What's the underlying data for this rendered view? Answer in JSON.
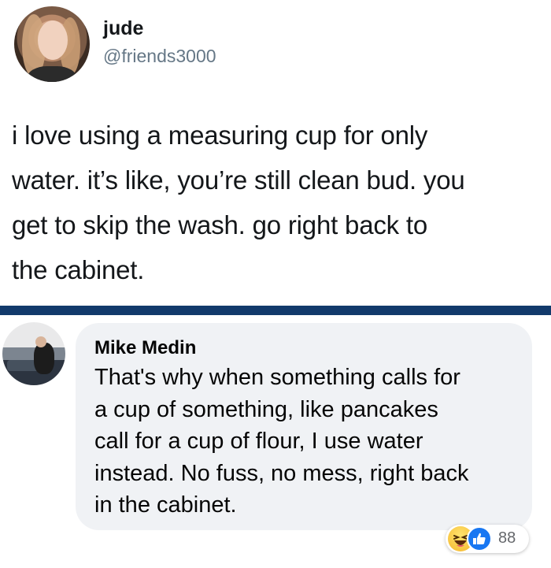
{
  "tweet": {
    "name": "jude",
    "handle": "@friends3000",
    "text": "i love using a measuring cup for only\nwater. it’s like, you’re still clean bud. you\nget to skip the wash. go right back to\nthe cabinet."
  },
  "comment": {
    "author": "Mike Medin",
    "text": "That's why when something calls for\na cup of something, like pancakes\ncall for a cup of flour, I use water\ninstead. No fuss, no mess, right back\nin the cabinet.",
    "reactions": {
      "icons": [
        "haha-icon",
        "like-icon"
      ],
      "count": "88"
    }
  },
  "colors": {
    "divider": "#123a6b",
    "bubble": "#f0f2f5",
    "handle": "#657786",
    "like": "#1877f2"
  }
}
